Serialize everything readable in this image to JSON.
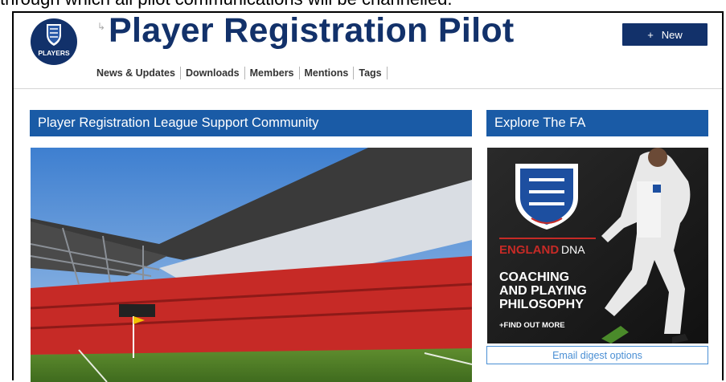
{
  "document": {
    "caption_line": "through which all pilot communications will be channelled."
  },
  "header": {
    "logo_text": "PLAYERS",
    "title": "Player Registration Pilot",
    "new_button": {
      "icon": "+",
      "label": "New"
    }
  },
  "nav": {
    "items": [
      "News & Updates",
      "Downloads",
      "Members",
      "Mentions",
      "Tags"
    ]
  },
  "main": {
    "heading": "Player Registration League Support Community"
  },
  "sidebar": {
    "heading": "Explore The FA",
    "ad": {
      "brand": "ENGLAND",
      "brand_suffix": "DNA",
      "line1": "COACHING",
      "line2": "AND PLAYING",
      "line3": "PHILOSOPHY",
      "cta": "+FIND OUT MORE"
    },
    "digest_button": "Email digest options"
  },
  "colors": {
    "brand_navy": "#12316a",
    "panel_blue": "#1a5ba6",
    "link_blue": "#4a8fd4"
  }
}
